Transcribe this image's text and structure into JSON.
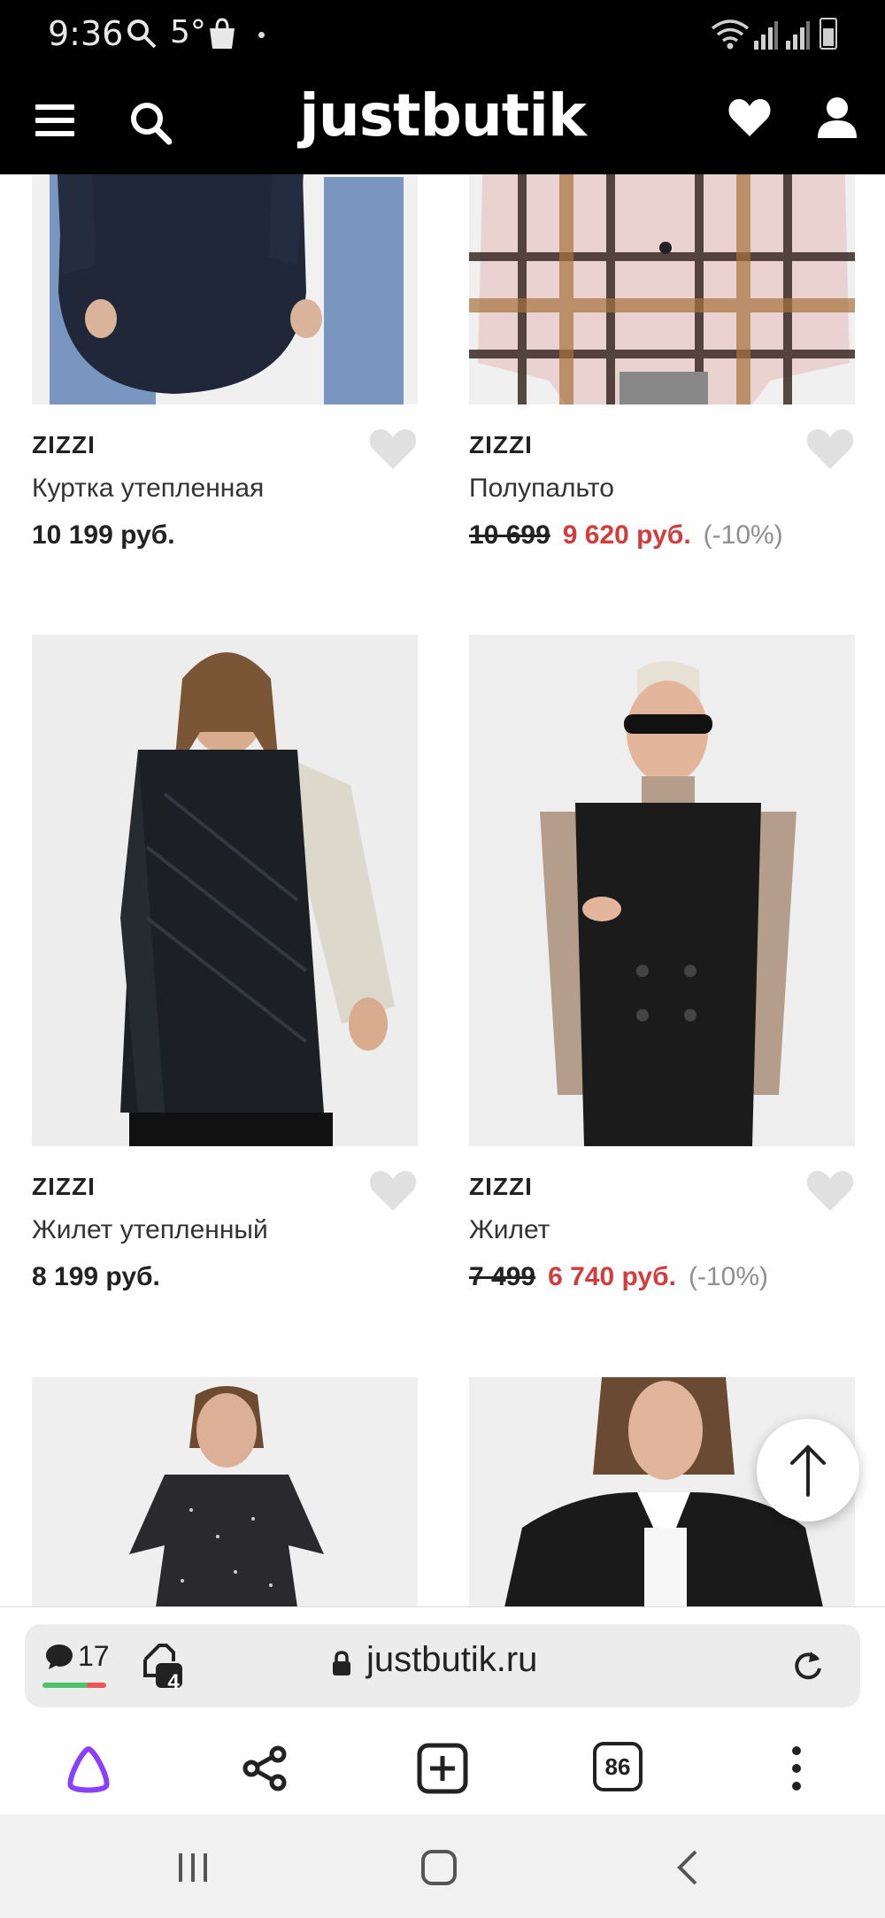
{
  "status_bar": {
    "time": "9:36",
    "temperature": "5°",
    "icons": [
      "search-icon",
      "shopping-bag-icon",
      "wifi-icon",
      "signal-icon",
      "battery-icon"
    ]
  },
  "header": {
    "logo": "justbutik",
    "icons": [
      "menu-icon",
      "search-icon",
      "heart-icon",
      "user-icon"
    ]
  },
  "products": [
    {
      "brand": "ZIZZI",
      "name": "Куртка утепленная",
      "price": "10 199 руб.",
      "old_price": "",
      "discount": ""
    },
    {
      "brand": "ZIZZI",
      "name": "Полупальто",
      "price": "9 620 руб.",
      "old_price": "10 699",
      "discount": "(-10%)"
    },
    {
      "brand": "ZIZZI",
      "name": "Жилет утепленный",
      "price": "8 199 руб.",
      "old_price": "",
      "discount": ""
    },
    {
      "brand": "ZIZZI",
      "name": "Жилет",
      "price": "6 740 руб.",
      "old_price": "7 499",
      "discount": "(-10%)"
    },
    {
      "brand": "",
      "name": "",
      "price": "",
      "old_price": "",
      "discount": ""
    },
    {
      "brand": "",
      "name": "",
      "price": "",
      "old_price": "",
      "discount": ""
    }
  ],
  "browser": {
    "chat_count": "17",
    "tabs_protected_count": "4",
    "url": "justbutik.ru",
    "open_tabs": "86"
  },
  "colors": {
    "sale_price": "#d23c3c",
    "alice_accent": "#8a3ffc"
  }
}
